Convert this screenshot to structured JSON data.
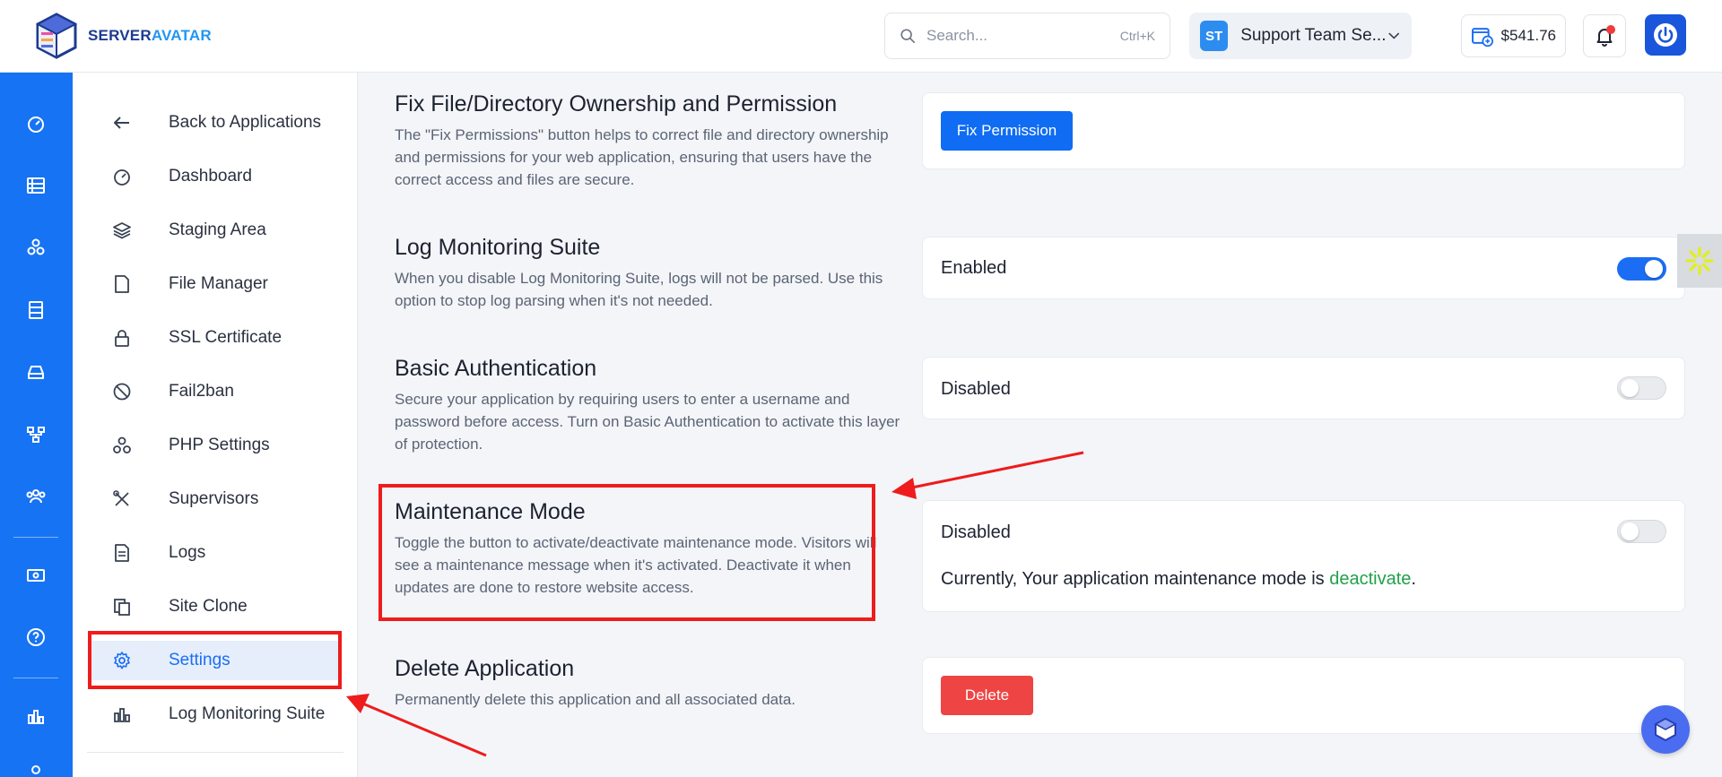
{
  "brand": {
    "name_part1": "SERVER",
    "name_part2": "AVATAR"
  },
  "search": {
    "placeholder": "Search...",
    "shortcut": "Ctrl+K"
  },
  "team": {
    "initials": "ST",
    "name": "Support Team Se..."
  },
  "wallet": {
    "balance": "$541.76"
  },
  "rail_icons": [
    "gauge-icon",
    "server-list-icon",
    "cluster-icon",
    "database-icon",
    "drive-icon",
    "network-icon",
    "team-icon",
    "billing-icon",
    "help-icon",
    "analytics-icon",
    "user-icon"
  ],
  "sidebar": {
    "items": [
      {
        "label": "Back to Applications",
        "icon": "arrow-left-icon"
      },
      {
        "label": "Dashboard",
        "icon": "gauge-icon"
      },
      {
        "label": "Staging Area",
        "icon": "layers-icon"
      },
      {
        "label": "File Manager",
        "icon": "file-icon"
      },
      {
        "label": "SSL Certificate",
        "icon": "lock-icon"
      },
      {
        "label": "Fail2ban",
        "icon": "ban-icon"
      },
      {
        "label": "PHP Settings",
        "icon": "php-icon"
      },
      {
        "label": "Supervisors",
        "icon": "tools-icon"
      },
      {
        "label": "Logs",
        "icon": "document-icon"
      },
      {
        "label": "Site Clone",
        "icon": "copy-icon"
      },
      {
        "label": "Settings",
        "icon": "gear-icon",
        "active": true
      },
      {
        "label": "Log Monitoring Suite",
        "icon": "bar-chart-icon"
      }
    ]
  },
  "sections": {
    "fix_permission": {
      "title": "Fix File/Directory Ownership and Permission",
      "description": "The \"Fix Permissions\" button helps to correct file and directory ownership and permissions for your web application, ensuring that users have the correct access and files are secure.",
      "button": "Fix Permission"
    },
    "log_monitoring": {
      "title": "Log Monitoring Suite",
      "description": "When you disable Log Monitoring Suite, logs will not be parsed. Use this option to stop log parsing when it's not needed.",
      "status": "Enabled",
      "enabled": true
    },
    "basic_auth": {
      "title": "Basic Authentication",
      "description": "Secure your application by requiring users to enter a username and password before access. Turn on Basic Authentication to activate this layer of protection.",
      "status": "Disabled",
      "enabled": false
    },
    "maintenance": {
      "title": "Maintenance Mode",
      "description": "Toggle the button to activate/deactivate maintenance mode. Visitors will see a maintenance message when it's activated. Deactivate it when updates are done to restore website access.",
      "status": "Disabled",
      "enabled": false,
      "current_prefix": "Currently, Your application maintenance mode is ",
      "current_value": "deactivate",
      "current_suffix": "."
    },
    "delete_app": {
      "title": "Delete Application",
      "description": "Permanently delete this application and all associated data.",
      "button": "Delete"
    }
  },
  "colors": {
    "brand_blue": "#1673f4",
    "primary": "#0f6cf3",
    "danger": "#ef4444",
    "success": "#22a04b",
    "annotation_red": "#ee1c1c"
  }
}
